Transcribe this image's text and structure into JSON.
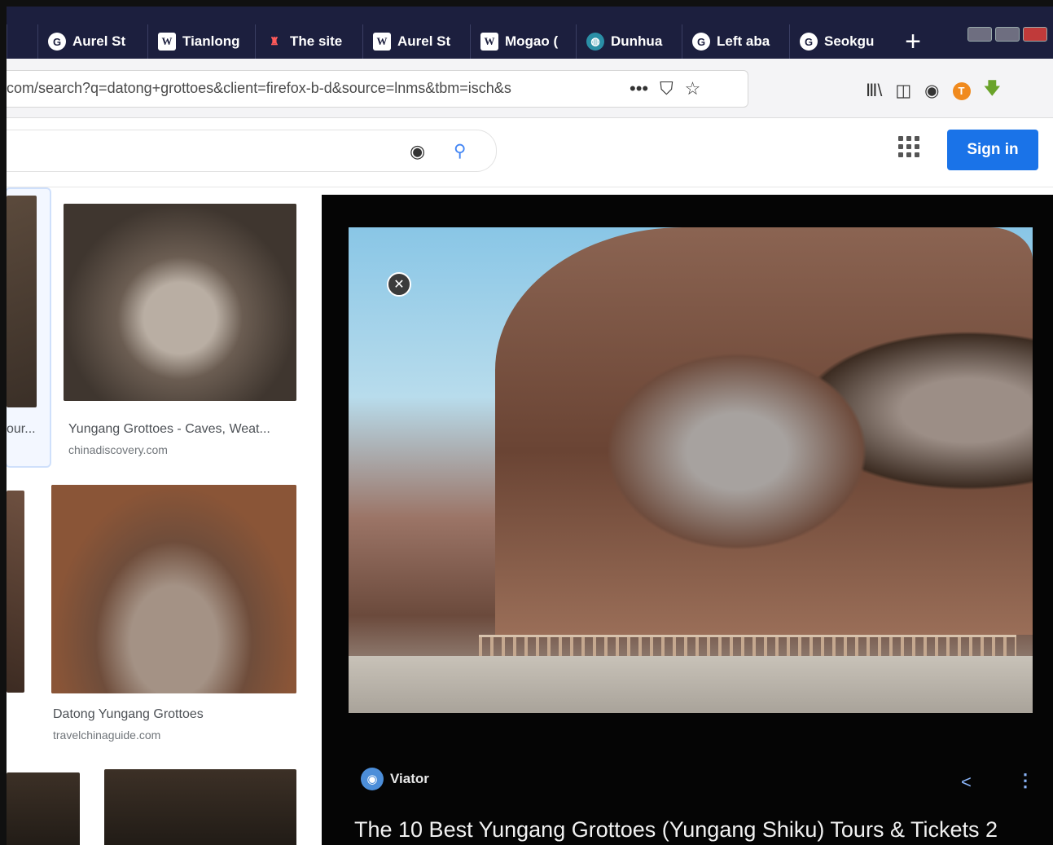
{
  "browser": {
    "tabs": [
      {
        "label": "",
        "icon": "partial-tab-icon"
      },
      {
        "label": "Aurel St",
        "icon": "google-icon"
      },
      {
        "label": "Tianlong",
        "icon": "wikipedia-icon"
      },
      {
        "label": "The site",
        "icon": "site-red-icon"
      },
      {
        "label": "Aurel St",
        "icon": "wikipedia-icon"
      },
      {
        "label": "Mogao (",
        "icon": "wikipedia-icon"
      },
      {
        "label": "Dunhua",
        "icon": "dunhuang-icon"
      },
      {
        "label": "Left aba",
        "icon": "google-icon"
      },
      {
        "label": "Seokgu",
        "icon": "google-icon"
      }
    ],
    "new_tab": "+",
    "url": "com/search?q=datong+grottoes&client=firefox-b-d&source=lnms&tbm=isch&s",
    "url_actions": {
      "more": "•••",
      "pocket": "⛉",
      "bookmark": "☆"
    },
    "toolbar": {
      "library": "Ⅲ\\",
      "sidebar": "◫",
      "account": "◉",
      "ext_orange": "T",
      "ext_green": "🡇"
    }
  },
  "google": {
    "sign_in": "Sign in",
    "camera_icon": "camera-icon",
    "search_icon": "search-icon"
  },
  "results": [
    {
      "title": "our...",
      "source": ""
    },
    {
      "title": "Yungang Grottoes - Caves, Weat...",
      "source": "chinadiscovery.com"
    },
    {
      "title": "",
      "source": ""
    },
    {
      "title": "Datong Yungang Grottoes",
      "source": "travelchinaguide.com"
    }
  ],
  "preview": {
    "close": "✕",
    "source": "Viator",
    "title": "The 10 Best Yungang Grottoes (Yungang Shiku) Tours & Tickets 2",
    "accent": "#8ab4f8"
  }
}
